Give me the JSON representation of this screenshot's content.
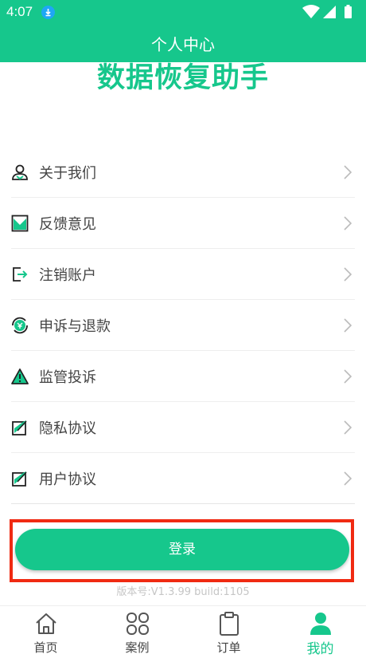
{
  "status_bar": {
    "time": "4:07"
  },
  "header": {
    "title": "个人中心"
  },
  "brand": {
    "title": "数据恢复助手"
  },
  "menu": {
    "items": [
      {
        "label": "关于我们",
        "icon": "about-us-icon"
      },
      {
        "label": "反馈意见",
        "icon": "feedback-icon"
      },
      {
        "label": "注销账户",
        "icon": "logout-account-icon"
      },
      {
        "label": "申诉与退款",
        "icon": "refund-icon"
      },
      {
        "label": "监管投诉",
        "icon": "warning-icon"
      },
      {
        "label": "隐私协议",
        "icon": "privacy-agreement-icon"
      },
      {
        "label": "用户协议",
        "icon": "user-agreement-icon"
      }
    ]
  },
  "login": {
    "label": "登录"
  },
  "version": "版本号:V1.3.99 build:1105",
  "nav": {
    "items": [
      {
        "label": "首页",
        "icon": "home-icon"
      },
      {
        "label": "案例",
        "icon": "grid-icon"
      },
      {
        "label": "订单",
        "icon": "clipboard-icon"
      },
      {
        "label": "我的",
        "icon": "user-icon",
        "active": true
      }
    ]
  },
  "colors": {
    "primary": "#16c78c",
    "highlight_border": "#f02a12",
    "download_badge": "#1ea7f5"
  }
}
